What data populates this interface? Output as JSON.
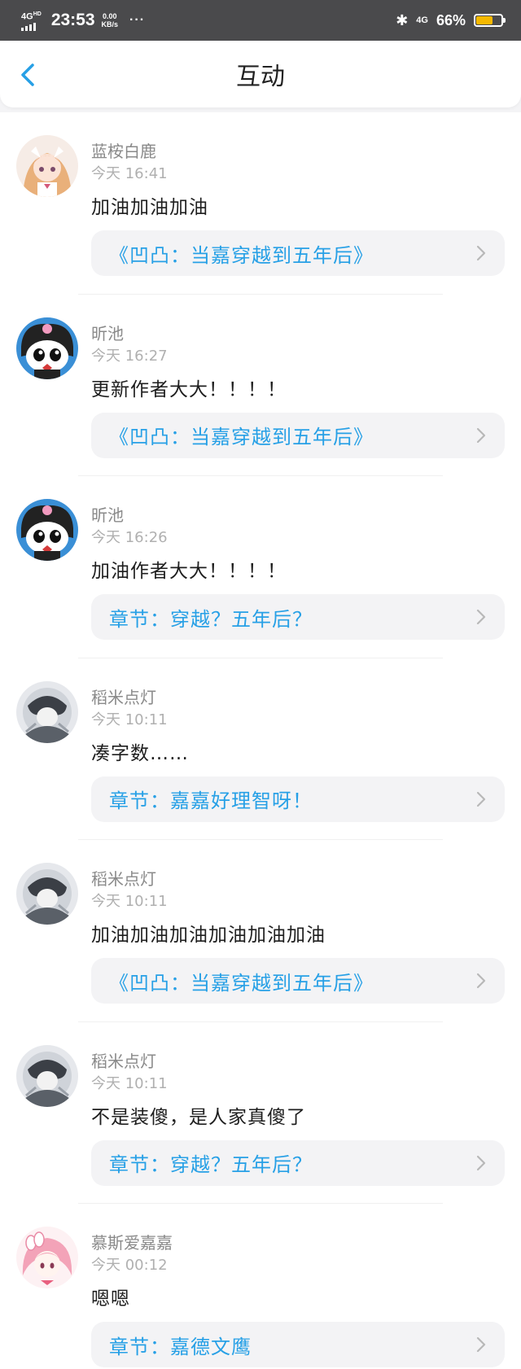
{
  "status": {
    "network": "4G",
    "network_sup": "HD",
    "time": "23:53",
    "speed_value": "0.00",
    "speed_unit": "KB/s",
    "dots": "···",
    "right_network": "4G",
    "battery": "66%",
    "battery_level": 0.66,
    "battery_color": "#f5b800"
  },
  "header": {
    "title": "互动"
  },
  "items": [
    {
      "name": "蓝桉白鹿",
      "time": "今天 16:41",
      "content": "加油加油加油",
      "link": "《凹凸：当嘉穿越到五年后》",
      "avatar": "avatar-anime-girl-icon"
    },
    {
      "name": "昕池",
      "time": "今天 16:27",
      "content": "更新作者大大！！！！",
      "link": "《凹凸：当嘉穿越到五年后》",
      "avatar": "avatar-kuromi-icon"
    },
    {
      "name": "昕池",
      "time": "今天 16:26",
      "content": "加油作者大大！！！！",
      "link": "章节：穿越？五年后？",
      "avatar": "avatar-kuromi-icon"
    },
    {
      "name": "稻米点灯",
      "time": "今天 10:11",
      "content": "凑字数……",
      "link": "章节：嘉嘉好理智呀！",
      "avatar": "avatar-sketch-icon"
    },
    {
      "name": "稻米点灯",
      "time": "今天 10:11",
      "content": "加油加油加油加油加油加油",
      "link": "《凹凸：当嘉穿越到五年后》",
      "avatar": "avatar-sketch-icon"
    },
    {
      "name": "稻米点灯",
      "time": "今天 10:11",
      "content": "不是装傻，是人家真傻了",
      "link": "章节：穿越？五年后？",
      "avatar": "avatar-sketch-icon"
    },
    {
      "name": "慕斯爱嘉嘉",
      "time": "今天 00:12",
      "content": "嗯嗯",
      "link": "章节：嘉德文鹰",
      "avatar": "avatar-pink-girl-icon"
    }
  ],
  "colors": {
    "accent": "#27a0e6",
    "statusbar": "#4a4a4c"
  }
}
